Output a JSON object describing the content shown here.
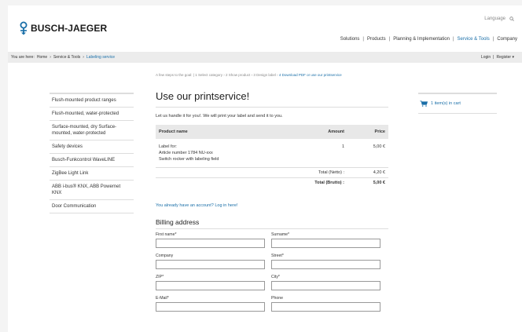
{
  "header": {
    "logo_text": "BUSCH-JAEGER",
    "language_label": "Language",
    "nav": [
      {
        "label": "Solutions",
        "active": false
      },
      {
        "label": "Products",
        "active": false
      },
      {
        "label": "Planning & Implementation",
        "active": false
      },
      {
        "label": "Service & Tools",
        "active": true
      },
      {
        "label": "Company",
        "active": false
      }
    ]
  },
  "breadcrumb": {
    "prefix": "You are here:",
    "items": [
      "Home",
      "›",
      "Service & Tools",
      "›",
      "Labeling service"
    ]
  },
  "account": {
    "login": "Login",
    "separator": "|",
    "register": "Register ▾"
  },
  "sidebar": {
    "items": [
      "Flush-mounted product ranges",
      "Flush-mounted, water-protected",
      "Surface-mounted, dry Surface-mounted, water-protected",
      "Safety devices",
      "Busch-Funkcontrol WaveLINE",
      "ZigBee Light Link",
      "ABB i-bus® KNX, ABB Powernet KNX",
      "Door Communication"
    ]
  },
  "steps": {
    "prefix": "A few steps to the goal:",
    "items": [
      "1 Select category",
      "2 Show product",
      "3 Design label",
      "4 Download PDF or use our printservice"
    ]
  },
  "main": {
    "title": "Use our printservice!",
    "intro": "Let us handle it for you!. We will print your label and send it to you.",
    "table": {
      "headers": {
        "product": "Product name",
        "amount": "Amount",
        "price": "Price"
      },
      "row": {
        "lines": [
          "Label for:",
          "Article number 1784 NU-xxx",
          "Switch rocker with labeling field"
        ],
        "amount": "1",
        "price": "5,00 €"
      },
      "net": {
        "label": "Total (Netto) :",
        "value": "4,20 €"
      },
      "gross": {
        "label": "Total (Brutto) :",
        "value": "5,00 €"
      }
    },
    "login_link": "You already have an account? Log in here!",
    "billing_title": "Billing address",
    "form": {
      "first_name": "First name*",
      "surname": "Surname*",
      "company": "Company",
      "street": "Street*",
      "zip": "ZIP*",
      "city": "City*",
      "email": "E-Mail*",
      "phone": "Phone"
    }
  },
  "cart": {
    "label": "1 item(s) in cart"
  },
  "colors": {
    "accent": "#1a6fa8",
    "header_bg": "#e8e8e8"
  }
}
